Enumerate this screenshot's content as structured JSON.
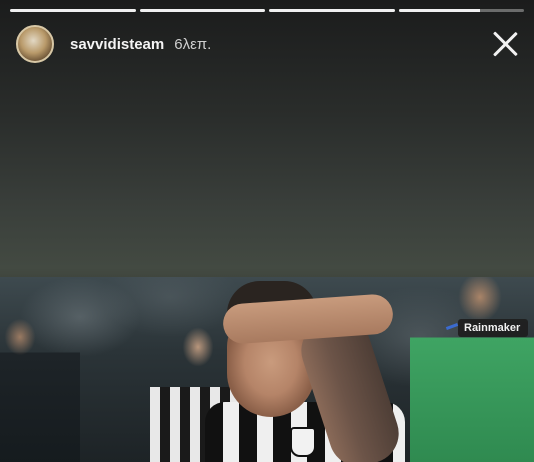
{
  "story": {
    "segments": [
      1,
      1,
      1,
      0.65
    ],
    "username": "savvidisteam",
    "timestamp": "6λεπ.",
    "close_icon": "close-icon",
    "avatar_icon": "profile-avatar"
  },
  "photo": {
    "watermark_tag": "Rainmaker"
  }
}
